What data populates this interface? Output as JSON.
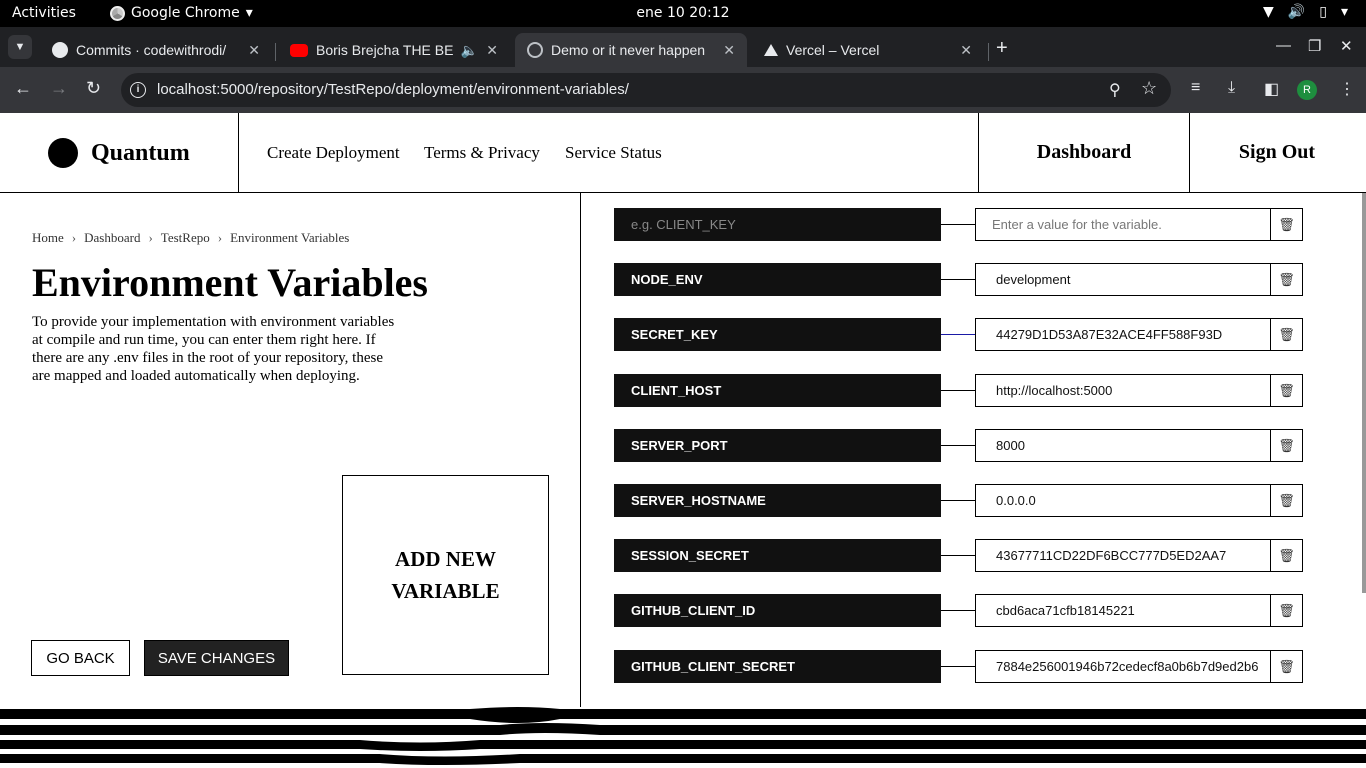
{
  "system": {
    "activities": "Activities",
    "app_name": "Google Chrome",
    "clock": "ene 10  20:12"
  },
  "browser": {
    "tabs": [
      {
        "title": "Commits · codewithrodi/",
        "icon": "github-icon"
      },
      {
        "title": "Boris Brejcha THE BE",
        "icon": "youtube-icon"
      },
      {
        "title": "Demo or it never happen",
        "icon": "globe-icon",
        "active": true
      },
      {
        "title": "Vercel – Vercel",
        "icon": "vercel-icon"
      }
    ],
    "url": "localhost:5000/repository/TestRepo/deployment/environment-variables/",
    "avatar_letter": "R"
  },
  "header": {
    "brand": "Quantum",
    "nav": [
      "Create Deployment",
      "Terms & Privacy",
      "Service Status"
    ],
    "dashboard": "Dashboard",
    "sign_out": "Sign Out"
  },
  "left": {
    "breadcrumb": [
      "Home",
      "Dashboard",
      "TestRepo",
      "Environment Variables"
    ],
    "title": "Environment Variables",
    "description": "To provide your implementation with environment variables at compile and run time, you can enter them right here. If there are any .env files in the root of your repository, these are mapped and loaded automatically when deploying.",
    "add_new": "ADD NEW VARIABLE",
    "go_back": "GO BACK",
    "save": "SAVE CHANGES"
  },
  "variables": {
    "new_key_placeholder": "e.g. CLIENT_KEY",
    "new_value_placeholder": "Enter a value for the variable.",
    "rows": [
      {
        "key": "NODE_ENV",
        "value": "development"
      },
      {
        "key": "SECRET_KEY",
        "value": "44279D1D53A87E32ACE4FF588F93D"
      },
      {
        "key": "CLIENT_HOST",
        "value": "http://localhost:5000"
      },
      {
        "key": "SERVER_PORT",
        "value": "8000"
      },
      {
        "key": "SERVER_HOSTNAME",
        "value": "0.0.0.0"
      },
      {
        "key": "SESSION_SECRET",
        "value": "43677711CD22DF6BCC777D5ED2AA7"
      },
      {
        "key": "GITHUB_CLIENT_ID",
        "value": "cbd6aca71cfb18145221"
      },
      {
        "key": "GITHUB_CLIENT_SECRET",
        "value": "7884e256001946b72cedecf8a0b6b7d9ed2b6"
      }
    ]
  }
}
